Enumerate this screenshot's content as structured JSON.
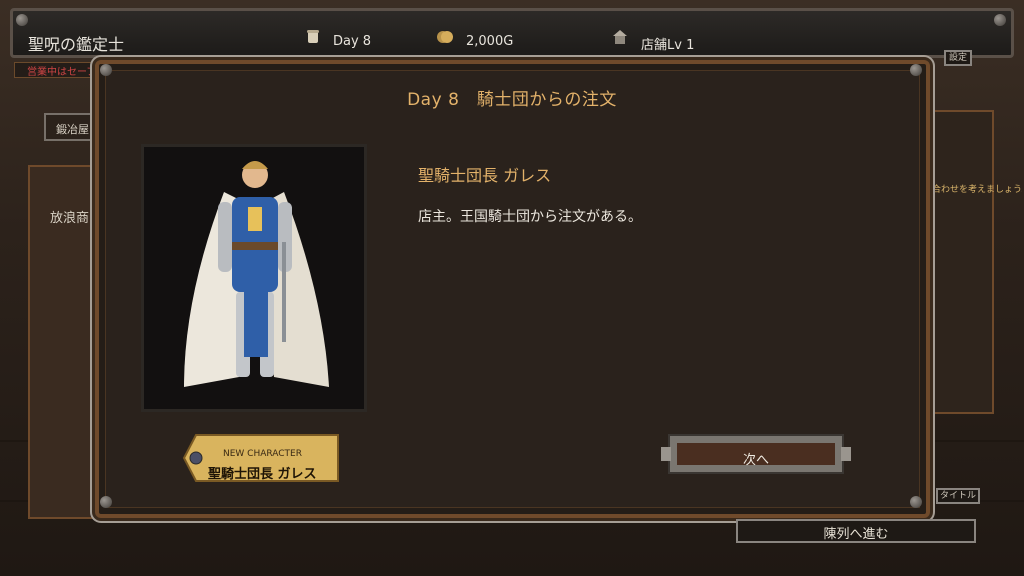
{
  "header": {
    "title": "聖呪の鑑定士",
    "day": "Day 8",
    "gold": "2,000G",
    "shop_level": "店舗Lv 1",
    "settings_label": "設定"
  },
  "background": {
    "save_note": "営業中はセーブ",
    "tab_smith": "鍛冶屋",
    "tab_wanderer": "放浪商",
    "right_hint": "合わせを考えましょう。",
    "title_button": "タイトル",
    "proceed_button": "陳列へ進む"
  },
  "dialog": {
    "title": "Day 8　騎士団からの注文",
    "character_name": "聖騎士団長 ガレス",
    "description": "店主。王国騎士団から注文がある。",
    "badge_top": "NEW CHARACTER",
    "badge_name": "聖騎士団長 ガレス",
    "next_button": "次へ"
  },
  "icons": {
    "day": "scroll-icon",
    "gold": "coins-icon",
    "shop": "shop-icon"
  },
  "colors": {
    "accent_gold": "#e3b26a",
    "dialog_bg": "#241d17",
    "frame_wood": "#6f4a2b"
  }
}
